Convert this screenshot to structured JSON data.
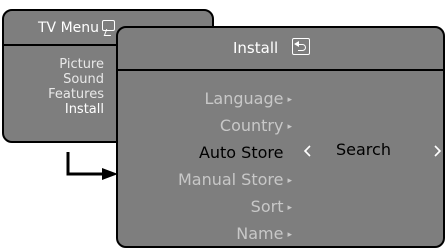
{
  "tv_menu": {
    "title": "TV Menu",
    "icon": "tv-menu-icon",
    "items": [
      {
        "label": "Picture"
      },
      {
        "label": "Sound"
      },
      {
        "label": "Features"
      },
      {
        "label": "Install"
      }
    ],
    "active_item": "Install"
  },
  "install_menu": {
    "title": "Install",
    "icon": "install-return-icon",
    "items": [
      {
        "label": "Language",
        "has_arrow": true
      },
      {
        "label": "Country",
        "has_arrow": true
      },
      {
        "label": "Auto Store",
        "has_arrow": false
      },
      {
        "label": "Manual Store",
        "has_arrow": true
      },
      {
        "label": "Sort",
        "has_arrow": true
      },
      {
        "label": "Name",
        "has_arrow": true
      }
    ],
    "selected_item": "Auto Store",
    "selected_value": "Search"
  },
  "colors": {
    "panel": "#7e7e7e",
    "text_light": "#ffffff",
    "text_dim": "#c8c8c8",
    "text_selected": "#000000",
    "border": "#000000"
  }
}
